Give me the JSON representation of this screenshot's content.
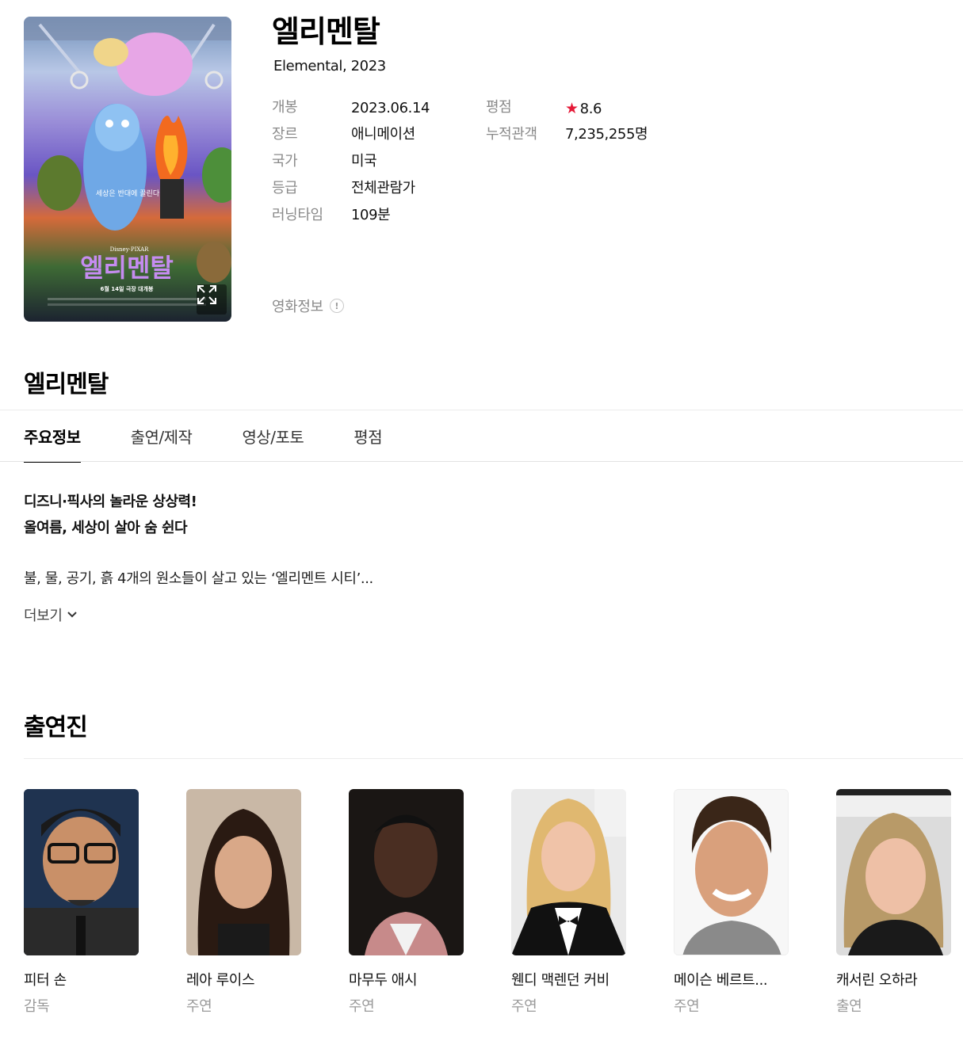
{
  "movie": {
    "title": "엘리멘탈",
    "subtitle": "Elemental, 2023",
    "info_left": [
      {
        "label": "개봉",
        "value": "2023.06.14"
      },
      {
        "label": "장르",
        "value": "애니메이션"
      },
      {
        "label": "국가",
        "value": "미국"
      },
      {
        "label": "등급",
        "value": "전체관람가"
      },
      {
        "label": "러닝타임",
        "value": "109분"
      }
    ],
    "rating_label": "평점",
    "rating_star": "★",
    "rating_value": "8.6",
    "audience_label": "누적관객",
    "audience_value": "7,235,255명",
    "movie_info_link": "영화정보",
    "info_icon": "!"
  },
  "poster": {
    "tagline": "세상은 반대에 끌린다",
    "logo_brand": "Disney·PIXAR",
    "logo_title": "엘리멘탈",
    "release_line": "6월 14일 극장 대개봉",
    "expand_icon": "expand-icon"
  },
  "section": {
    "title": "엘리멘탈"
  },
  "tabs": [
    {
      "label": "주요정보",
      "active": true
    },
    {
      "label": "출연/제작",
      "active": false
    },
    {
      "label": "영상/포토",
      "active": false
    },
    {
      "label": "평점",
      "active": false
    }
  ],
  "synopsis": {
    "headline_1": "디즈니·픽사의 놀라운 상상력!",
    "headline_2": "올여름, 세상이 살아 숨 쉰다",
    "body": "불, 물, 공기, 흙 4개의 원소들이 살고 있는 ‘엘리멘트 시티’...",
    "more_label": "더보기"
  },
  "cast": {
    "title": "출연진",
    "people": [
      {
        "name": "피터 손",
        "role": "감독"
      },
      {
        "name": "레아 루이스",
        "role": "주연"
      },
      {
        "name": "마무두 애시",
        "role": "주연"
      },
      {
        "name": "웬디 맥렌던 커비",
        "role": "주연"
      },
      {
        "name": "메이슨 베르트...",
        "role": "주연"
      },
      {
        "name": "캐서린 오하라",
        "role": "출연"
      }
    ]
  },
  "colors": {
    "star": "#e51937",
    "label_gray": "#8a8a8a",
    "divider": "#ececec"
  }
}
